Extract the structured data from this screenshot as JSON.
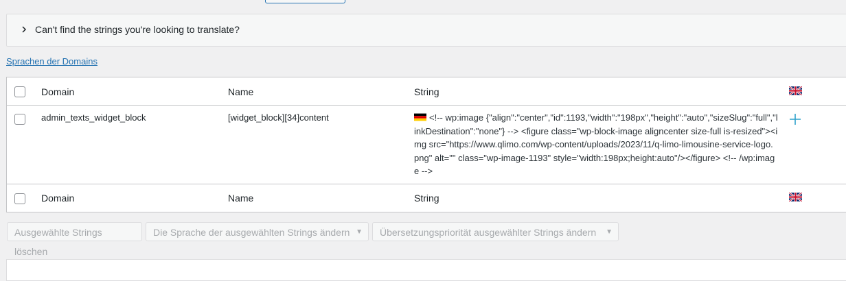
{
  "notice": {
    "text": "Can't find the strings you're looking to translate?"
  },
  "languages_link": "Sprachen der Domains",
  "table": {
    "headers": {
      "domain": "Domain",
      "name": "Name",
      "string": "String"
    },
    "rows": [
      {
        "domain": "admin_texts_widget_block",
        "name": "[widget_block][34]content",
        "string": "<!-- wp:image {\"align\":\"center\",\"id\":1193,\"width\":\"198px\",\"height\":\"auto\",\"sizeSlug\":\"full\",\"linkDestination\":\"none\"} --> <figure class=\"wp-block-image aligncenter size-full is-resized\"><img src=\"https://www.qlimo.com/wp-content/uploads/2023/11/q-limo-limousine-service-logo.png\" alt=\"\" class=\"wp-image-1193\" style=\"width:198px;height:auto\"/></figure> <!-- /wp:image -->",
        "source_flag": "de-flag-icon"
      }
    ],
    "language_flag": "uk-flag-icon"
  },
  "bulk_actions": {
    "delete_label": "Ausgewählte Strings löschen",
    "change_language_label": "Die Sprache der ausgewählten Strings ändern",
    "change_priority_label": "Übersetzungspriorität ausgewählter Strings ändern"
  },
  "colors": {
    "link": "#2271b1",
    "accent_plus": "#2ea2cc"
  }
}
